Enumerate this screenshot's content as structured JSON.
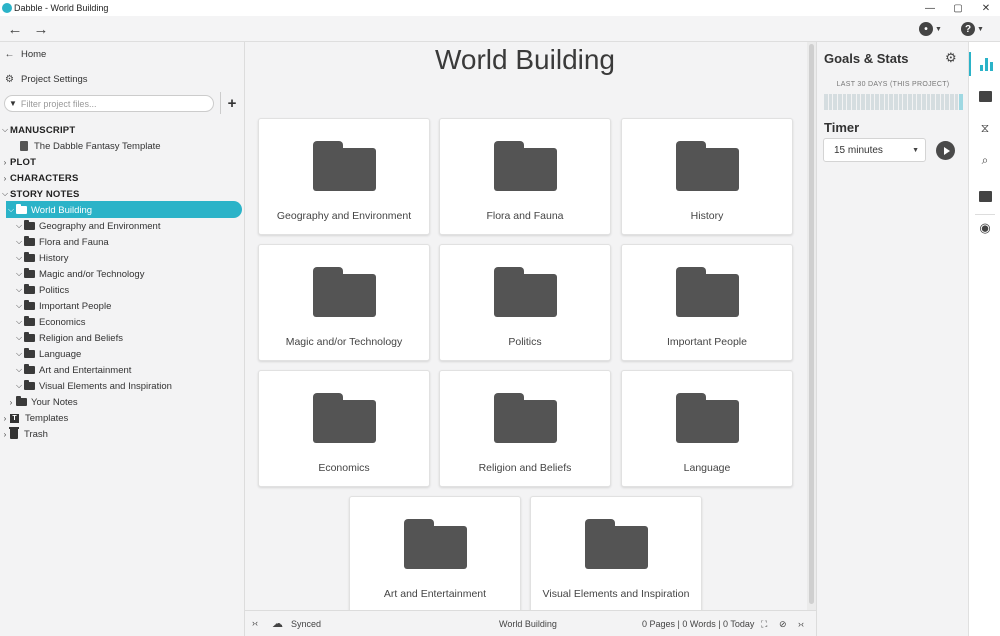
{
  "window": {
    "title": "Dabble - World Building",
    "controls": [
      "—",
      "▢",
      "✕"
    ]
  },
  "toolbar": {
    "back_icon": "arrow-left-icon",
    "forward_icon": "arrow-right-icon",
    "account_icon": "account-circle-icon",
    "help_icon": "help-circle-icon"
  },
  "sidebar": {
    "home": "Home",
    "project_settings": "Project Settings",
    "filter_placeholder": "Filter project files...",
    "manuscript": "MANUSCRIPT",
    "manuscript_doc": "The Dabble Fantasy Template",
    "plot": "PLOT",
    "characters": "CHARACTERS",
    "story_notes": "STORY NOTES",
    "selected": "World Building",
    "children": [
      "Geography and Environment",
      "Flora and Fauna",
      "History",
      "Magic and/or Technology",
      "Politics",
      "Important People",
      "Economics",
      "Religion and Beliefs",
      "Language",
      "Art and Entertainment",
      "Visual Elements and Inspiration"
    ],
    "your_notes": "Your Notes",
    "templates": "Templates",
    "trash": "Trash"
  },
  "main": {
    "title": "World Building",
    "cards": [
      "Geography and Environment",
      "Flora and Fauna",
      "History",
      "Magic and/or Technology",
      "Politics",
      "Important People",
      "Economics",
      "Religion and Beliefs",
      "Language",
      "Art and Entertainment",
      "Visual Elements and Inspiration"
    ]
  },
  "statusbar": {
    "sync": "Synced",
    "doc": "World Building",
    "counts": "0 Pages | 0 Words | 0 Today"
  },
  "goals": {
    "title": "Goals & Stats",
    "subtitle": "LAST 30 DAYS (THIS PROJECT)",
    "timer_label": "Timer",
    "timer_value": "15 minutes"
  },
  "colors": {
    "accent": "#2bb3c8",
    "folder": "#545454",
    "background": "#f3f3f4"
  }
}
